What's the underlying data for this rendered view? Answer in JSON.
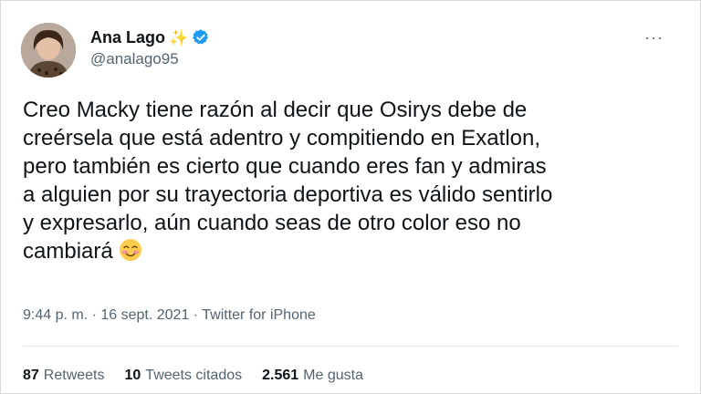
{
  "author": {
    "name": "Ana Lago",
    "sparkle": "✨",
    "handle": "@analago95",
    "verified_color": "#1d9bf0"
  },
  "more_label": "···",
  "tweet": {
    "text": "Creo Macky tiene razón al decir que Osirys debe de\ncreérsela que está adentro y compitiendo en Exatlon,\npero también es cierto que cuando eres fan y admiras\na alguien por su trayectoria deportiva es válido sentirlo\ny expresarlo, aún cuando seas de otro color eso no\ncambiará",
    "emoji": "smiling-face-with-blush-icon"
  },
  "meta": "9:44 p. m. · 16 sept. 2021 · Twitter for iPhone",
  "stats": {
    "retweets_count": "87",
    "retweets_label": "Retweets",
    "quotes_count": "10",
    "quotes_label": "Tweets citados",
    "likes_count": "2.561",
    "likes_label": "Me gusta"
  }
}
